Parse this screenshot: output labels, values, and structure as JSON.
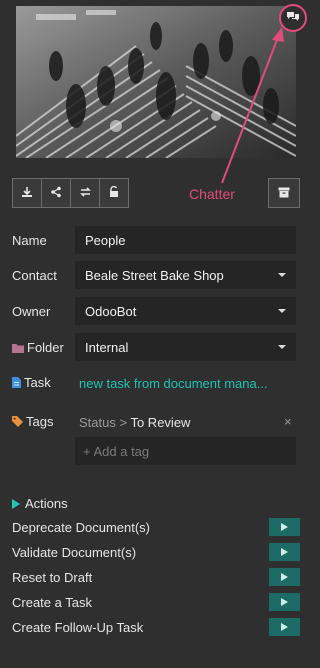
{
  "annotation": {
    "label": "Chatter",
    "color": "#e04d7a"
  },
  "icons": {
    "chatter": "chat-bubbles-icon",
    "toolbar": [
      "download-icon",
      "share-icon",
      "replace-icon",
      "unlock-icon"
    ],
    "archive": "archive-icon",
    "folder": "folder-icon",
    "task": "document-icon",
    "tags": "tag-icon",
    "actions": "triangle-right-icon",
    "action_run": "play-icon"
  },
  "fields": {
    "name": {
      "label": "Name",
      "value": "People"
    },
    "contact": {
      "label": "Contact",
      "value": "Beale Street Bake Shop"
    },
    "owner": {
      "label": "Owner",
      "value": "OdooBot"
    },
    "folder": {
      "label": "Folder",
      "value": "Internal"
    },
    "task": {
      "label": "Task",
      "value": "new task from document mana..."
    },
    "tags": {
      "label": "Tags",
      "tag_category": "Status",
      "tag_separator": ">",
      "tag_value": "To Review",
      "remove": "×",
      "placeholder": "+ Add a tag"
    }
  },
  "actions": {
    "title": "Actions",
    "items": [
      "Deprecate Document(s)",
      "Validate Document(s)",
      "Reset to Draft",
      "Create a Task",
      "Create Follow-Up Task"
    ]
  },
  "colors": {
    "accent": "#1fc2b4",
    "run_button": "#1d6b66",
    "background": "#2f2f2f"
  }
}
